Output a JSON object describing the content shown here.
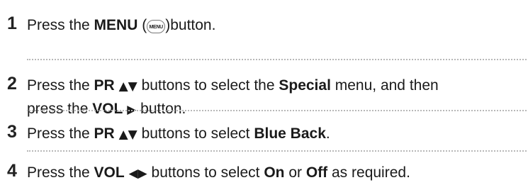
{
  "steps": [
    {
      "number": "1",
      "parts": {
        "a": "Press the ",
        "b": "MENU",
        "c": " (",
        "d": ")button."
      },
      "menu_badge": "MENU"
    },
    {
      "number": "2",
      "parts": {
        "a": "Press the ",
        "b": "PR",
        "c": "▲▼",
        "d": " buttons to select the ",
        "e": "Special",
        "f": " menu, and then",
        "g": "press the ",
        "h": "VOL",
        "i": "▶",
        "j": " button."
      }
    },
    {
      "number": "3",
      "parts": {
        "a": "Press the ",
        "b": "PR",
        "c": "▲▼",
        "d": " buttons to select ",
        "e": "Blue Back",
        "f": "."
      }
    },
    {
      "number": "4",
      "parts": {
        "a": "Press the ",
        "b": "VOL",
        "c": "◀▶",
        "d": " buttons to select ",
        "e": "On",
        "f": " or ",
        "g": "Off",
        "h": " as required."
      }
    }
  ]
}
